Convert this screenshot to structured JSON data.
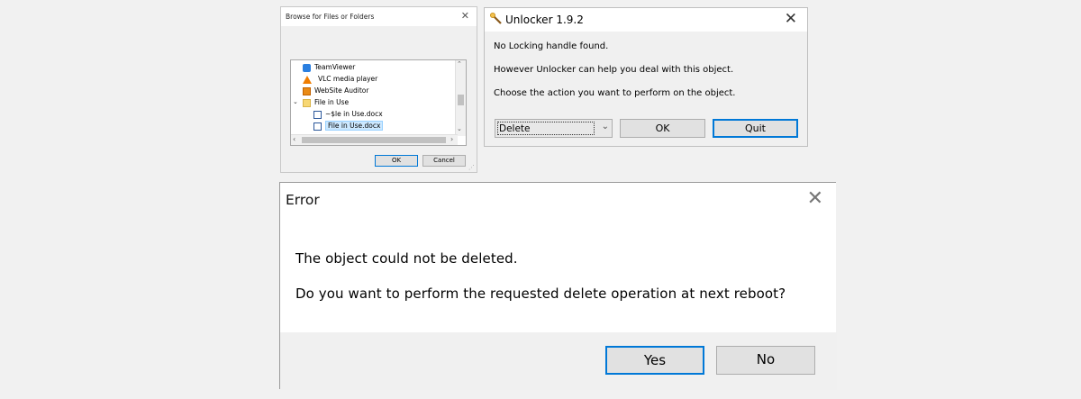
{
  "browse_dialog": {
    "title": "Browse for Files or Folders",
    "close_glyph": "✕",
    "tree_items": [
      {
        "label": "TeamViewer",
        "icon": "teamviewer-icon"
      },
      {
        "label": "VLC media player",
        "icon": "vlc-icon"
      },
      {
        "label": "WebSite Auditor",
        "icon": "website-auditor-icon"
      },
      {
        "label": "File in Use",
        "icon": "folder-icon",
        "expanded": true
      },
      {
        "label": "~$le in Use.docx",
        "icon": "word-doc-icon"
      },
      {
        "label": "File in Use.docx",
        "icon": "word-doc-icon",
        "selected": true
      }
    ],
    "ok_label": "OK",
    "cancel_label": "Cancel"
  },
  "unlocker_dialog": {
    "title": "Unlocker 1.9.2",
    "close_glyph": "✕",
    "line1": "No Locking handle found.",
    "line2": "However Unlocker can help you deal with this object.",
    "line3": "Choose the action you want to perform on the object.",
    "action_selected": "Delete",
    "ok_label": "OK",
    "quit_label": "Quit"
  },
  "error_dialog": {
    "title": "Error",
    "close_glyph": "✕",
    "message1": "The object could not be deleted.",
    "message2": "Do you want to perform the requested delete operation at next reboot?",
    "yes_label": "Yes",
    "no_label": "No"
  },
  "colors": {
    "accent": "#0078d7",
    "dialog_bg": "#f0f0f0",
    "selection_bg": "#cce8ff"
  }
}
